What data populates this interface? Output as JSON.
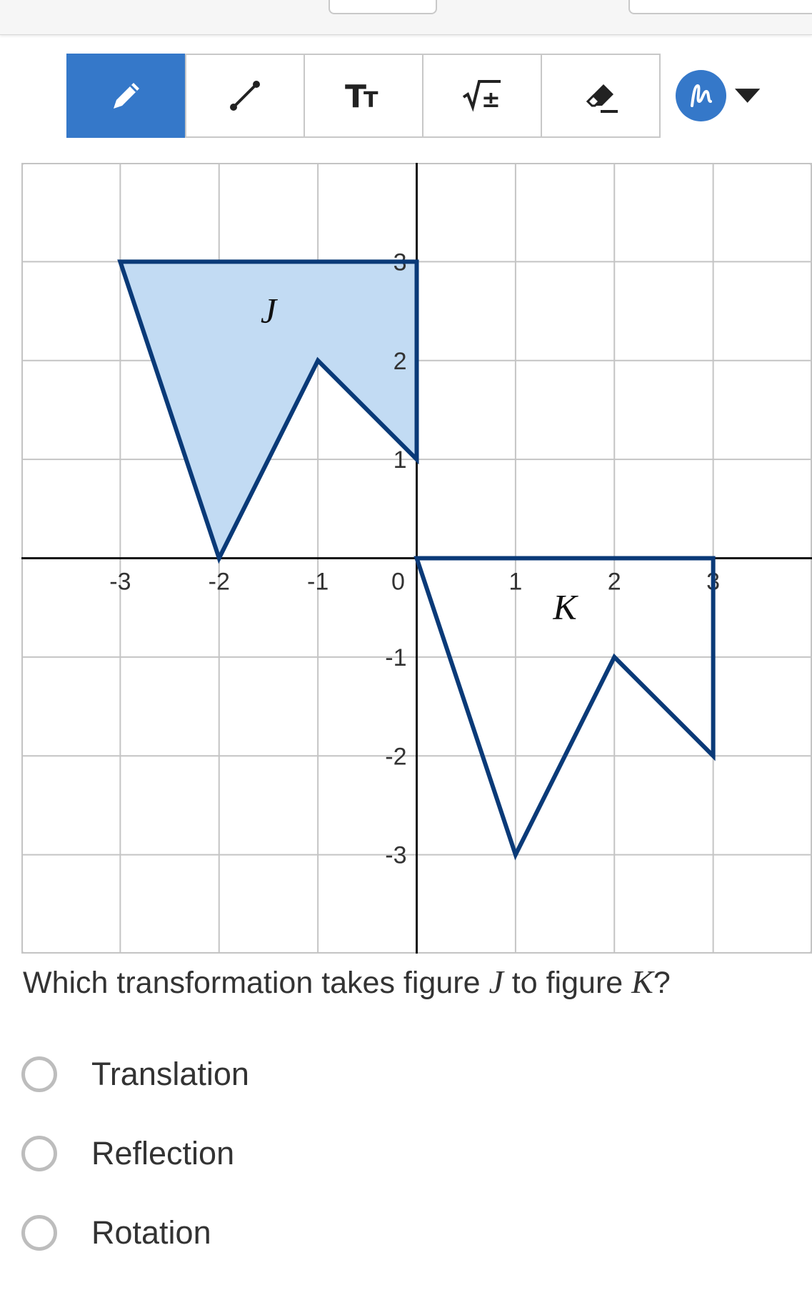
{
  "toolbar": {
    "tools": [
      {
        "icon": "pencil-icon",
        "active": true
      },
      {
        "icon": "line-segment-icon",
        "active": false
      },
      {
        "icon": "text-size-icon",
        "label": "TT",
        "active": false
      },
      {
        "icon": "math-symbols-icon",
        "label": "√±",
        "active": false
      },
      {
        "icon": "eraser-icon",
        "active": false
      }
    ],
    "color_picker": {
      "icon": "scribble-icon",
      "color": "#3578c9",
      "caret": "▾"
    }
  },
  "chart_data": {
    "type": "coordinate-grid",
    "xlim": [
      -4,
      4
    ],
    "ylim": [
      -4,
      4
    ],
    "grid": true,
    "x_ticks": [
      "-3",
      "-2",
      "-1",
      "0",
      "1",
      "2",
      "3"
    ],
    "y_ticks": [
      "3",
      "2",
      "1",
      "-1",
      "-2",
      "-3"
    ],
    "figures": [
      {
        "label": "J",
        "fill": "#c2dbf3",
        "stroke": "#0a3a78",
        "vertices": [
          [
            -3,
            3
          ],
          [
            0,
            3
          ],
          [
            0,
            1
          ],
          [
            -1,
            2
          ],
          [
            -2,
            0
          ]
        ],
        "label_at": [
          -1.5,
          2.5
        ]
      },
      {
        "label": "K",
        "fill": "none",
        "stroke": "#0a3a78",
        "vertices": [
          [
            0,
            0
          ],
          [
            3,
            0
          ],
          [
            3,
            -2
          ],
          [
            2,
            -1
          ],
          [
            1,
            -3
          ]
        ],
        "label_at": [
          1.5,
          -0.5
        ]
      }
    ]
  },
  "question": {
    "prefix": "Which transformation takes figure ",
    "var1": "J",
    "middle": " to figure ",
    "var2": "K",
    "suffix": "?"
  },
  "options": [
    {
      "label": "Translation",
      "selected": false
    },
    {
      "label": "Reflection",
      "selected": false
    },
    {
      "label": "Rotation",
      "selected": false
    }
  ]
}
